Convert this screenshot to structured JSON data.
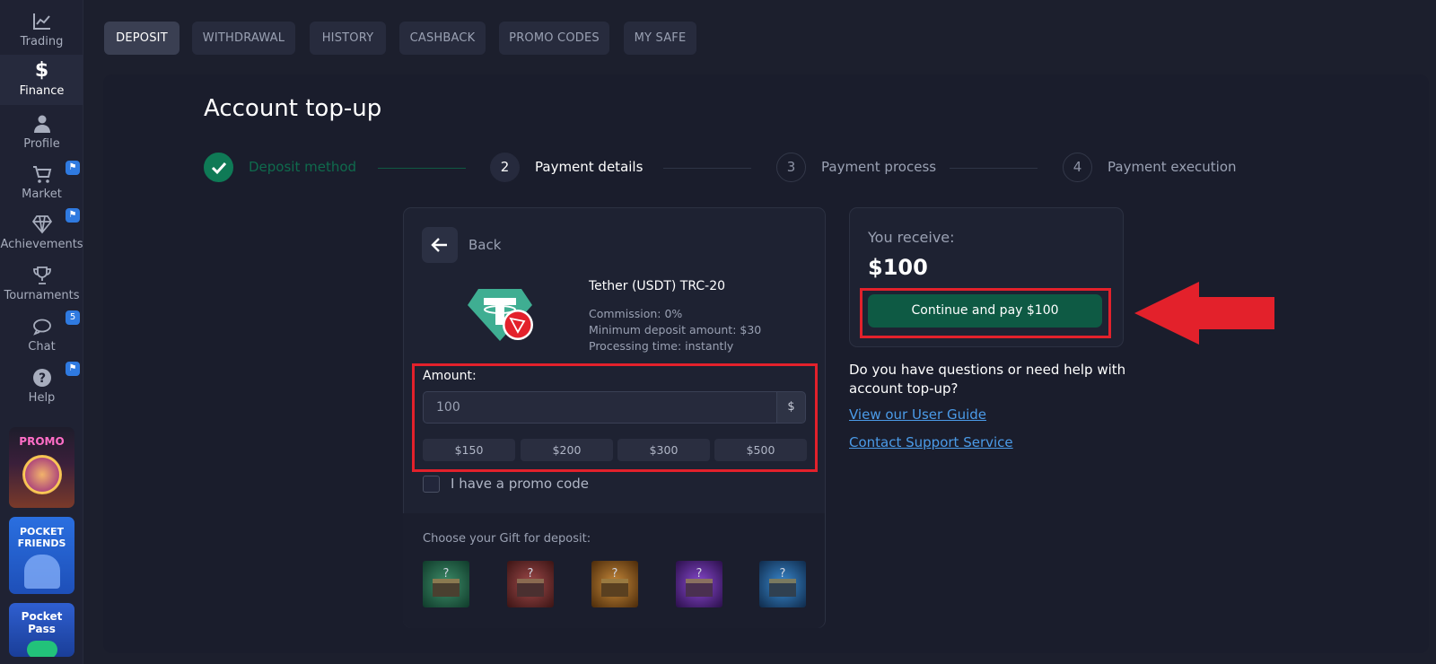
{
  "sidebar": {
    "items": [
      {
        "label": "Trading",
        "icon": "chart-line-icon"
      },
      {
        "label": "Finance",
        "icon": "dollar-icon"
      },
      {
        "label": "Profile",
        "icon": "user-icon"
      },
      {
        "label": "Market",
        "icon": "cart-icon"
      },
      {
        "label": "Achievements",
        "icon": "diamond-icon"
      },
      {
        "label": "Tournaments",
        "icon": "trophy-icon"
      },
      {
        "label": "Chat",
        "icon": "chat-icon"
      },
      {
        "label": "Help",
        "icon": "help-icon"
      }
    ],
    "chat_badge": "5",
    "cards": [
      {
        "label": "PROMO"
      },
      {
        "label": "POCKET FRIENDS"
      },
      {
        "label": "Pocket Pass"
      }
    ]
  },
  "tabs": [
    "DEPOSIT",
    "WITHDRAWAL",
    "HISTORY",
    "CASHBACK",
    "PROMO CODES",
    "MY SAFE"
  ],
  "active_tab": "DEPOSIT",
  "page_title": "Account top-up",
  "steps": [
    {
      "number": "",
      "label": "Deposit method",
      "state": "done"
    },
    {
      "number": "2",
      "label": "Payment details",
      "state": "current"
    },
    {
      "number": "3",
      "label": "Payment process",
      "state": "upcoming"
    },
    {
      "number": "4",
      "label": "Payment execution",
      "state": "upcoming"
    }
  ],
  "payment": {
    "back_label": "Back",
    "method_name": "Tether (USDT) TRC-20",
    "commission": "Commission: 0%",
    "minimum": "Minimum deposit amount: $30",
    "processing": "Processing time: instantly",
    "amount_label": "Amount:",
    "amount_value": "100",
    "currency": "$",
    "presets": [
      "$150",
      "$200",
      "$300",
      "$500"
    ],
    "promo_label": "I have a promo code",
    "gift_label": "Choose your Gift for deposit:"
  },
  "summary": {
    "receive_label": "You receive:",
    "receive_value": "$100",
    "pay_button": "Continue and pay $100",
    "help_question": "Do you have questions or need help with account top-up?",
    "guide_link": "View our User Guide",
    "support_link": "Contact Support Service"
  },
  "colors": {
    "accent_green": "#0f7a56",
    "annotation_red": "#e3212b",
    "link_blue": "#4b9be8"
  }
}
